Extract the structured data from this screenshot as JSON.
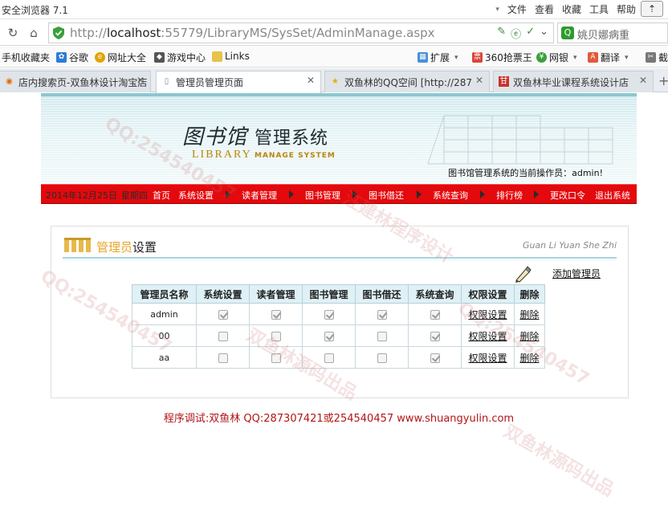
{
  "browser": {
    "window_title": "安全浏览器 7.1",
    "menus": [
      "文件",
      "查看",
      "收藏",
      "工具",
      "帮助"
    ],
    "url_prefix": "http://",
    "url_host": "localhost",
    "url_rest": ":55779/LibraryMS/SysSet/AdminManage.aspx",
    "search_text": "姚贝娜病重",
    "favorites": [
      {
        "label": "手机收藏夹"
      },
      {
        "label": "谷歌"
      },
      {
        "label": "网址大全"
      },
      {
        "label": "游戏中心"
      },
      {
        "label": "Links"
      },
      {
        "label": "扩展"
      },
      {
        "label": "360抢票王"
      },
      {
        "label": "网银"
      },
      {
        "label": "翻译"
      },
      {
        "label": "截图"
      }
    ],
    "tabs": [
      {
        "label": "店内搜索页-双鱼林设计淘宝店"
      },
      {
        "label": "管理员管理页面"
      },
      {
        "label": "双鱼林的QQ空间 [http://287"
      },
      {
        "label": "双鱼林毕业课程系统设计店"
      }
    ]
  },
  "header": {
    "logo_calligraphy": "图书馆",
    "logo_main": "管理系统",
    "logo_en1": "LIBRARY",
    "logo_en2": "MANAGE SYSTEM",
    "operator_label": "图书馆管理系统的当前操作员：",
    "operator_name": "admin!"
  },
  "nav": {
    "date": "2014年12月25日",
    "weekday": "星期四",
    "items": [
      "首页",
      "系统设置",
      "读者管理",
      "图书管理",
      "图书借还",
      "系统查询",
      "排行榜",
      "更改口令",
      "退出系统"
    ]
  },
  "panel": {
    "title_highlight": "管理员",
    "title_rest": "设置",
    "pinyin": "Guan Li Yuan She Zhi",
    "add_label": "添加管理员"
  },
  "table": {
    "headers": [
      "管理员名称",
      "系统设置",
      "读者管理",
      "图书管理",
      "图书借还",
      "系统查询",
      "权限设置",
      "删除"
    ],
    "rows": [
      {
        "name": "admin",
        "perms": [
          true,
          true,
          true,
          true,
          true
        ],
        "perm_link": "权限设置",
        "delete_link": "删除"
      },
      {
        "name": "00",
        "perms": [
          false,
          false,
          true,
          false,
          true
        ],
        "perm_link": "权限设置",
        "delete_link": "删除"
      },
      {
        "name": "aa",
        "perms": [
          false,
          false,
          false,
          false,
          true
        ],
        "perm_link": "权限设置",
        "delete_link": "删除"
      }
    ]
  },
  "footer": {
    "text": "程序调试:双鱼林 QQ:287307421或254540457 www.shuangyulin.com"
  },
  "watermark": {
    "texts": [
      "QQ:254540457",
      "汪建林程序设计",
      "双鱼林源码出品"
    ]
  },
  "colors": {
    "nav_red": "#e3090d",
    "header_blue": "#dff1f6",
    "footer_red": "#b21515",
    "title_orange": "#e8a52a"
  }
}
